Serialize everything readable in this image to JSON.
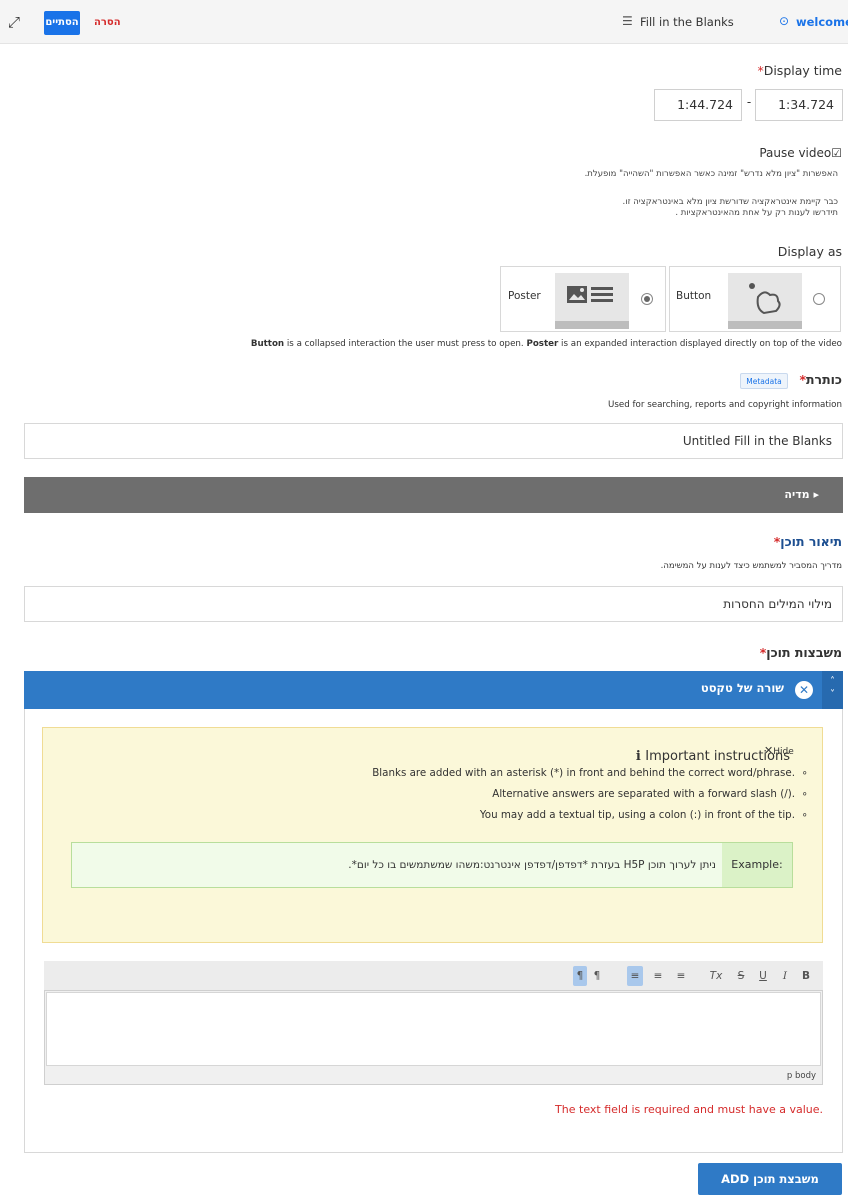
{
  "topbar": {
    "finish_label": "הסתיים",
    "remove_label": "הסרה",
    "library_name": "Fill in the Blanks",
    "welcome_label": "welcome"
  },
  "display_time": {
    "label": "Display time",
    "start": "1:44.724",
    "separator": "-",
    "end": "1:34.724"
  },
  "pause_video": {
    "label": "Pause video",
    "checked": true,
    "note": "האפשרות \"ציון מלא נדרש\" זמינה כאשר האפשרות \"השהייה\" מופעלת.",
    "warning_line1": "כבר קיימת אינטראקציה שדורשת ציון מלא באינטראקציה זו.",
    "warning_line2": "תידרשו לענות רק על אחת מהאינטראקציות ."
  },
  "display_as": {
    "label": "Display as",
    "options": [
      {
        "label": "Button",
        "selected": false
      },
      {
        "label": "Poster",
        "selected": true
      }
    ],
    "help_bold_1": "Button",
    "help_text_1": " is a collapsed interaction the user must press to open. ",
    "help_bold_2": "Poster",
    "help_text_2": " is an expanded interaction displayed directly on top of the video"
  },
  "title_field": {
    "label": "כותרת",
    "metadata_label": "Metadata",
    "help": "Used for searching, reports and copyright information",
    "value": "Untitled Fill in the Blanks"
  },
  "media_section": {
    "label": "מדיה"
  },
  "description_field": {
    "label": "תיאור תוכן",
    "help": "מדריך המסביר למשתמש כיצד לענות על המשימה.",
    "value": "מילוי המילים החסרות"
  },
  "content_blocks": {
    "label": "משבצות תוכן",
    "item_title": "שורה של טקסט",
    "instructions": {
      "title": "Important instructions",
      "hide_label": "Hide",
      "bullets": [
        "Blanks are added with an asterisk (*) in front and behind the correct word/phrase.",
        "Alternative answers are separated with a forward slash (/).",
        "You may add a textual tip, using a colon (:) in front of the tip."
      ],
      "example_label": "Example:",
      "example_text": "ניתן לערוך תוכן H5P בעזרת *דפדפן/דפדפן אינטרנט:משהו שמשתמשים בו כל יום*."
    },
    "editor": {
      "toolbar": [
        "¶",
        "¶",
        "≡",
        "≡",
        "≡",
        "Tx",
        "S",
        "U",
        "I",
        "B"
      ],
      "path": "p  body",
      "value": ""
    },
    "error": "The text field is required and must have a value.",
    "add_label": "ADD משבצת תוכן"
  },
  "colors": {
    "accent": "#2f7ac6",
    "error": "#d52b2b",
    "finish": "#1a73e8"
  }
}
